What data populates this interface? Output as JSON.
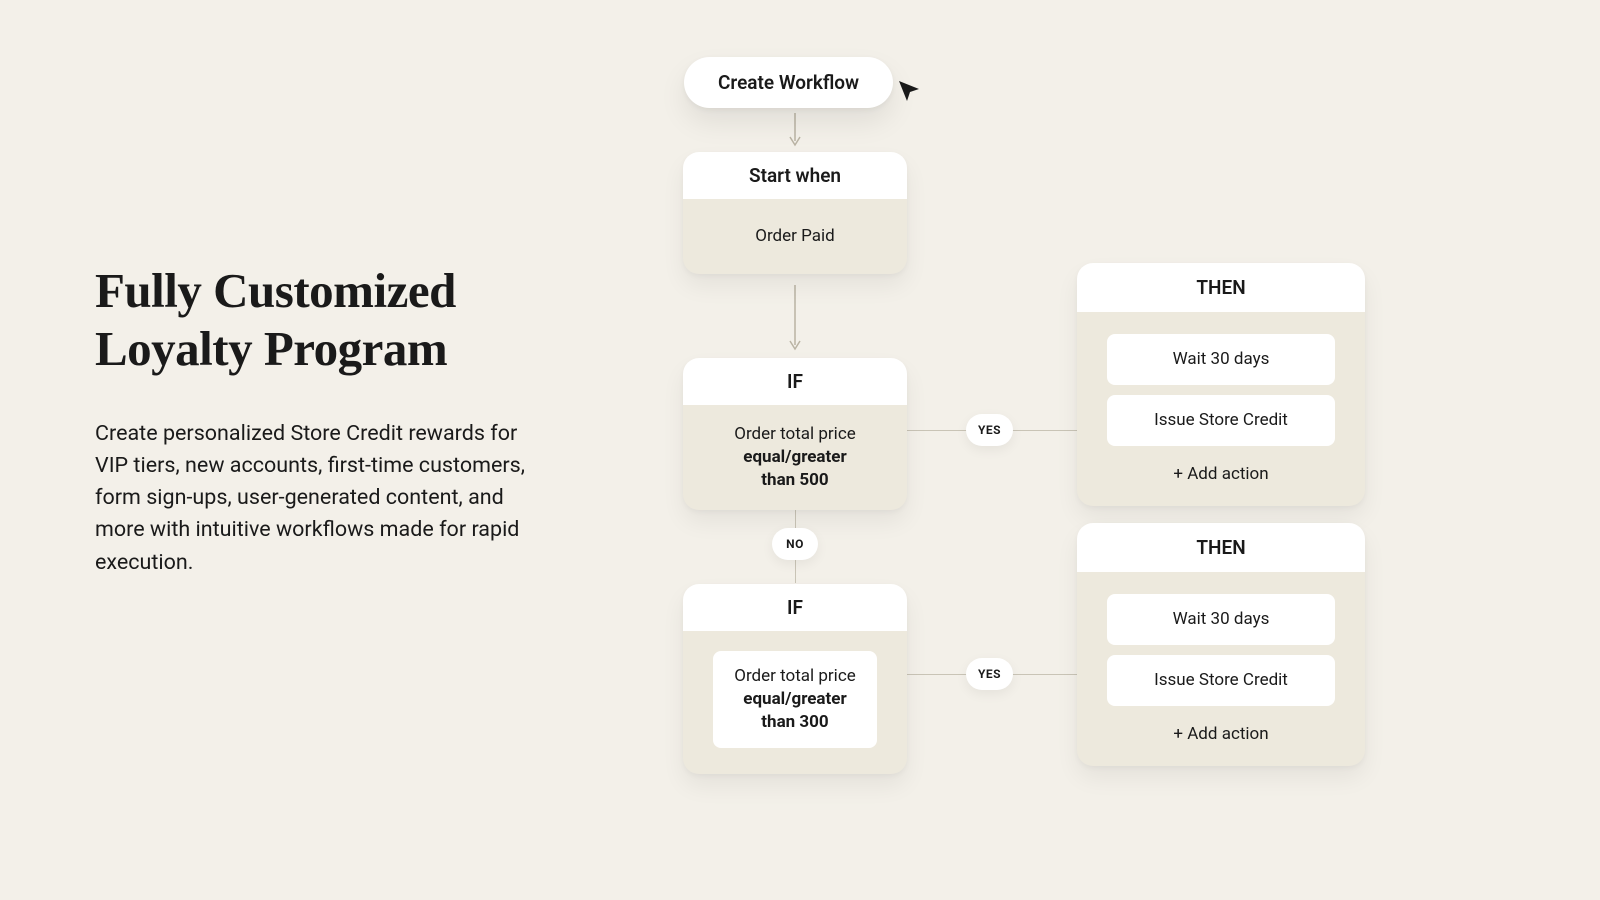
{
  "left": {
    "headline_line1": "Fully Customized",
    "headline_line2": "Loyalty Program",
    "body": "Create personalized Store Credit rewards for VIP tiers, new accounts, first-time customers, form sign-ups, user-generated content, and more with intuitive workflows made for rapid execution."
  },
  "workflow": {
    "create_button": "Create Workflow",
    "start": {
      "header": "Start when",
      "body": "Order Paid"
    },
    "if1": {
      "header": "IF",
      "line1": "Order total price",
      "line2": "equal/greater",
      "line3": "than 500"
    },
    "if2": {
      "header": "IF",
      "line1": "Order total price",
      "line2": "equal/greater",
      "line3": "than 300"
    },
    "then1": {
      "header": "THEN",
      "action1": "Wait 30 days",
      "action2": "Issue Store Credit",
      "add": "+ Add action"
    },
    "then2": {
      "header": "THEN",
      "action1": "Wait 30 days",
      "action2": "Issue Store Credit",
      "add": "+ Add action"
    },
    "badges": {
      "yes1": "YES",
      "no": "NO",
      "yes2": "YES"
    }
  }
}
